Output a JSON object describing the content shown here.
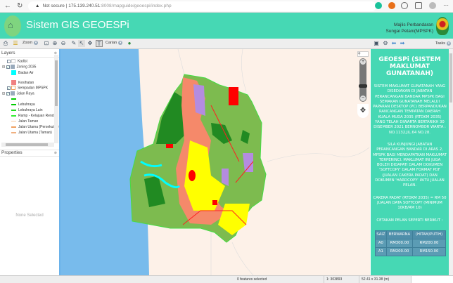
{
  "browser": {
    "security": "Not secure",
    "url_host": "175.139.240.51",
    "url_path": ":8008/mapguide/geoespi/index.php"
  },
  "header": {
    "title": "Sistem GIS GEOESPi",
    "council_line1": "Majlis Perbandaran",
    "council_line2": "Sungai Petani(MPSPK)"
  },
  "toolbar": {
    "zoom_label": "Zoom",
    "search_label": "Carian"
  },
  "layers": {
    "title": "Layers",
    "items": [
      {
        "label": "Kadist"
      },
      {
        "label": "Zoning 2035"
      },
      {
        "label": "Badan Air",
        "color": "#00ffff"
      },
      {
        "label": "Kesihatan",
        "color": "#f08080"
      },
      {
        "label": "Sempadan MPSPK"
      },
      {
        "label": "Jalan Raya"
      },
      {
        "label": "",
        "color": "#00cc00"
      },
      {
        "label": "Lebuhraya",
        "color": "#00cc00"
      },
      {
        "label": "Lebuhraya Lain",
        "color": "#22dd22"
      },
      {
        "label": "Ramp - Kelajuan Rendah",
        "color": "#33ee33"
      },
      {
        "label": "Jalan Taman",
        "color": "#f8c8a0"
      },
      {
        "label": "Jalan Utama (Persekutuan)",
        "color": "#f0a060"
      },
      {
        "label": "Jalan Utama (Taman)",
        "color": "#f0b080"
      }
    ]
  },
  "properties": {
    "title": "Properties",
    "empty": "None Selected"
  },
  "right": {
    "tasks_label": "Tasks",
    "heading": "GEOESPi (SISTEM MAKLUMAT GUNATANAH)",
    "para1": "SISTEM MAKLUMAT GUNATANAH YANG DISEDIAKAN DI JABATAN PERANCANGAN BANDAR MPSPK BAGI SEMAKAN GUNATANAH MELALUI PAPARAN DESKTOP (PC) BERPANDUKAN RANCANGAN TEMPATAN DAERAH KUALA MUDA 2035 (RTDKM 2035) YANG TELAH DIWARTA BERTARIKH 30 DISEMBER 2021 BERNOMBOR WARTA : NO.1132,JIL.64 NO.28.",
    "para2": "SILA KUNJUNGI JABATAN PERANCANGAN BANDAR DI ARAS 2, MPSPK BAGI MENDAPATKAN MAKLUMAT TERPERINCI. MAKLUMAT INI JUGA BOLEH DIDAPATI DALAM DOKUMEN 'SOFTCOPY' DALAM FORMAT PDF (JUALAN CAKERA PADAT) DAN DOKUMEN 'HARDCOPY' IAITU JUALAN PELAN.",
    "para3": "CAKERA PADAT (RTDKM 2035) = RM 50 JUALAN DATA SOFTCOPY (MINIMUM 10KB/RM 10)",
    "para4": "CETAKAN PELAN SEPERTI BERIKUT :",
    "table": {
      "headers": [
        "SAIZ",
        "BERWARNA",
        "(HITAM/PUTIH)"
      ],
      "rows": [
        [
          "A0",
          "RM300.00",
          "RM200.00"
        ],
        [
          "A1",
          "RM200.00",
          "RM150.00"
        ]
      ]
    }
  },
  "status": {
    "selection": "0 features selected",
    "scale": "1: 303893",
    "size": "52.41 x 31.38 (m)"
  },
  "colors": {
    "accent": "#46d8b4",
    "sea": "#78bbec",
    "land": "#fdf1e8"
  }
}
